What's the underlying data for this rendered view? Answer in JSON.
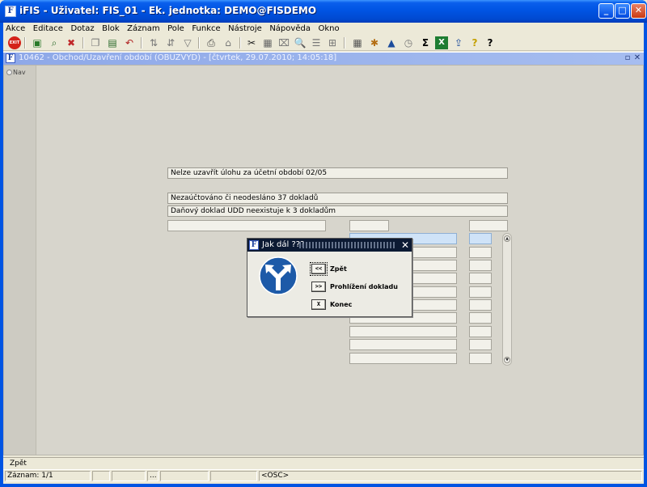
{
  "window": {
    "app_icon": "F",
    "title": "iFIS - Uživatel: FIS_01 - Ek. jednotka: DEMO@FISDEMO",
    "minimize": "_",
    "maximize": "□",
    "close": "✕"
  },
  "menu": [
    {
      "label": "Akce"
    },
    {
      "label": "Editace"
    },
    {
      "label": "Dotaz"
    },
    {
      "label": "Blok"
    },
    {
      "label": "Záznam"
    },
    {
      "label": "Pole"
    },
    {
      "label": "Funkce"
    },
    {
      "label": "Nástroje"
    },
    {
      "label": "Nápověda"
    },
    {
      "label": "Okno"
    }
  ],
  "toolbar": {
    "exit_label": "EXIT",
    "icons": [
      "exit-icon",
      "save-icon",
      "print-preview-icon",
      "delete-icon",
      "copy-icon",
      "db-icon",
      "undo-icon",
      "sort-asc-icon",
      "sort-desc-icon",
      "filter-icon",
      "printer-icon",
      "printer-setup-icon",
      "cut-icon",
      "paste-icon",
      "clear-icon",
      "find-icon",
      "list-icon",
      "tree-icon",
      "calculator-icon",
      "settings-icon",
      "chart-icon",
      "clock-icon",
      "sum-icon",
      "excel-icon",
      "export-icon",
      "help-icon",
      "info-help-icon"
    ],
    "glyphs": {
      "save": "▣",
      "preview": "⌕",
      "delete": "✖",
      "copy": "❐",
      "db": "▤",
      "undo": "↶",
      "sort_asc": "⇅",
      "sort_desc": "⇵",
      "filter": "▽",
      "printer": "⎙",
      "printer_setup": "⌂",
      "cut": "✂",
      "paste": "▦",
      "clear": "⌧",
      "find": "🔍",
      "list": "☰",
      "tree": "⊞",
      "calc": "▦",
      "settings": "✱",
      "chart": "▲",
      "clock": "◷",
      "sum": "Σ",
      "excel": "X",
      "export": "⇪",
      "help": "?",
      "info": "?"
    }
  },
  "inner_window": {
    "icon": "F",
    "title": "10462 - Obchod/Uzavření období (OBUZVYD) - [čtvrtek, 29.07.2010; 14:05:18]",
    "restore": "▫",
    "close": "✕"
  },
  "nav": {
    "label": "Nav"
  },
  "messages": [
    "Nelze uzavřít úlohu za účetní období 02/05",
    "Nezaúčtováno či neodesláno 37 dokladů",
    "Daňový doklad UDD neexistuje k 3 dokladům"
  ],
  "scroll": {
    "up": "▲",
    "down": "▼"
  },
  "dialog": {
    "icon": "F",
    "title": "Jak dál ???",
    "close": "✕",
    "sign_icon": "fork-arrow-sign-icon",
    "sign_color": "#1d5aa8",
    "buttons": [
      {
        "symbol": "<<",
        "label": "Zpět"
      },
      {
        "symbol": ">>",
        "label": "Prohlížení dokladu"
      },
      {
        "symbol": "X",
        "label": "Konec"
      }
    ]
  },
  "hint": {
    "text": "Zpět"
  },
  "status": {
    "record": "Záznam: 1/1",
    "cell2": "",
    "cell3": "",
    "cell4": "...",
    "cell5": "",
    "cell6": "",
    "mode": "<OSC>"
  }
}
